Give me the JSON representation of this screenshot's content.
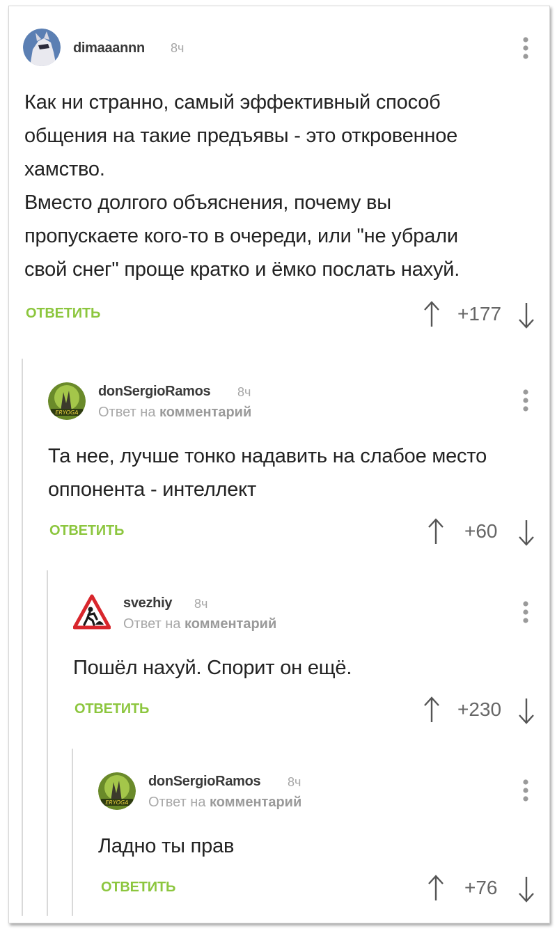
{
  "comments": [
    {
      "username": "dimaaannn",
      "time": "8ч",
      "reply_prefix": "",
      "reply_target": "",
      "lines": [
        "Как ни странно, самый эффективный способ",
        "общения на такие предъявы - это откровенное",
        "хамство.",
        "Вместо долгого объяснения, почему вы",
        "пропускаете кого-то в очереди, или \"не убрали",
        "свой снег\" проще кратко и ёмко послать нахуй."
      ],
      "reply_label": "ОТВЕТИТЬ",
      "rating": "+177"
    },
    {
      "username": "donSergioRamos",
      "time": "8ч",
      "reply_prefix": "Ответ на",
      "reply_target": "комментарий",
      "lines": [
        "Та нее, лучше тонко надавить на слабое место",
        "оппонента - интеллект"
      ],
      "reply_label": "ОТВЕТИТЬ",
      "rating": "+60"
    },
    {
      "username": "svezhiy",
      "time": "8ч",
      "reply_prefix": "Ответ на",
      "reply_target": "комментарий",
      "lines": [
        "Пошёл нахуй. Спорит он ещё."
      ],
      "reply_label": "ОТВЕТИТЬ",
      "rating": "+230"
    },
    {
      "username": "donSergioRamos",
      "time": "8ч",
      "reply_prefix": "Ответ на",
      "reply_target": "комментарий",
      "lines": [
        "Ладно ты прав"
      ],
      "reply_label": "ОТВЕТИТЬ",
      "rating": "+76"
    }
  ],
  "colors": {
    "reply_green": "#8cc63e",
    "text": "#222222",
    "muted": "#a6a6a6",
    "thread_line": "#d9d9d9"
  },
  "icons": {
    "upvote": "arrow-up-icon",
    "downvote": "arrow-down-icon",
    "menu": "more-vertical-icon"
  }
}
